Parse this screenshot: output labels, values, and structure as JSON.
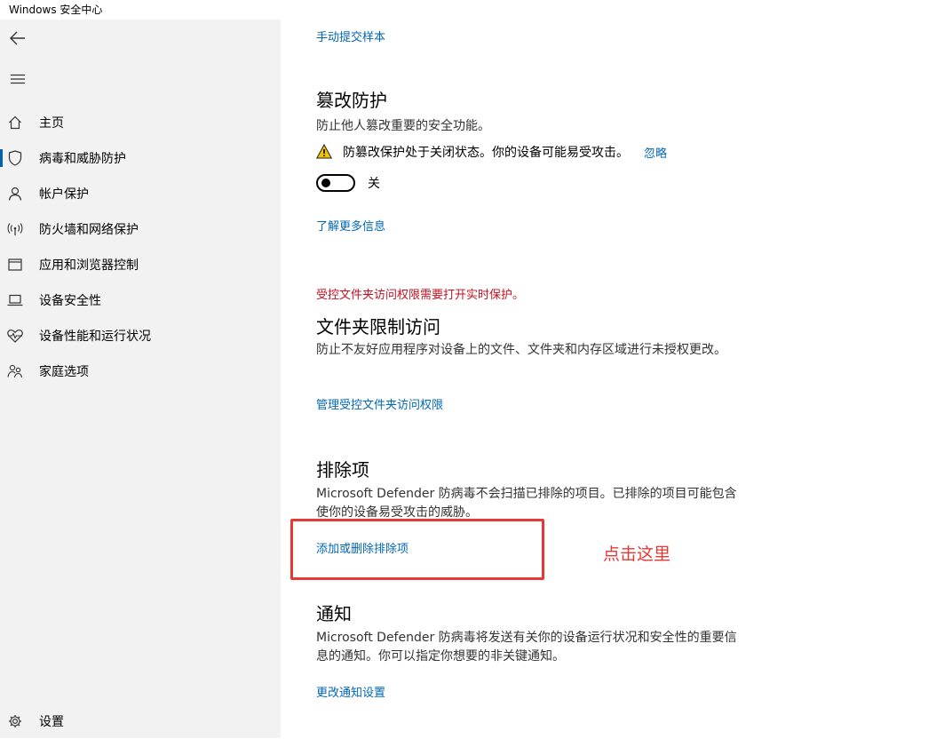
{
  "window": {
    "title": "Windows 安全中心"
  },
  "sidebar": {
    "items": [
      {
        "label": "主页",
        "icon": "home-icon"
      },
      {
        "label": "病毒和威胁防护",
        "icon": "shield-icon",
        "selected": true
      },
      {
        "label": "帐户保护",
        "icon": "person-icon"
      },
      {
        "label": "防火墙和网络保护",
        "icon": "wireless-icon"
      },
      {
        "label": "应用和浏览器控制",
        "icon": "app-window-icon"
      },
      {
        "label": "设备安全性",
        "icon": "laptop-icon"
      },
      {
        "label": "设备性能和运行状况",
        "icon": "heart-pulse-icon"
      },
      {
        "label": "家庭选项",
        "icon": "family-icon"
      }
    ],
    "settings_label": "设置"
  },
  "main": {
    "submit_sample_link": "手动提交样本",
    "tamper": {
      "title": "篡改防护",
      "desc": "防止他人篡改重要的安全功能。",
      "warning": "防篡改保护处于关闭状态。你的设备可能易受攻击。",
      "ignore": "忽略",
      "toggle_state": "关",
      "learn_more": "了解更多信息"
    },
    "folder": {
      "notice": "受控文件夹访问权限需要打开实时保护。",
      "title": "文件夹限制访问",
      "desc": "防止不友好应用程序对设备上的文件、文件夹和内存区域进行未授权更改。",
      "link": "管理受控文件夹访问权限"
    },
    "exclusions": {
      "title": "排除项",
      "desc": "Microsoft Defender 防病毒不会扫描已排除的项目。已排除的项目可能包含使你的设备易受攻击的威胁。",
      "link": "添加或删除排除项"
    },
    "notifications": {
      "title": "通知",
      "desc": "Microsoft Defender 防病毒将发送有关你的设备运行状况和安全性的重要信息的通知。你可以指定你想要的非关键通知。",
      "link": "更改通知设置"
    }
  },
  "annotation": {
    "text": "点击这里"
  },
  "colors": {
    "link": "#0067b8",
    "warning_red": "#c50f1f",
    "annotation_red": "#e53935",
    "sidebar_bg": "#f2f2f2"
  }
}
